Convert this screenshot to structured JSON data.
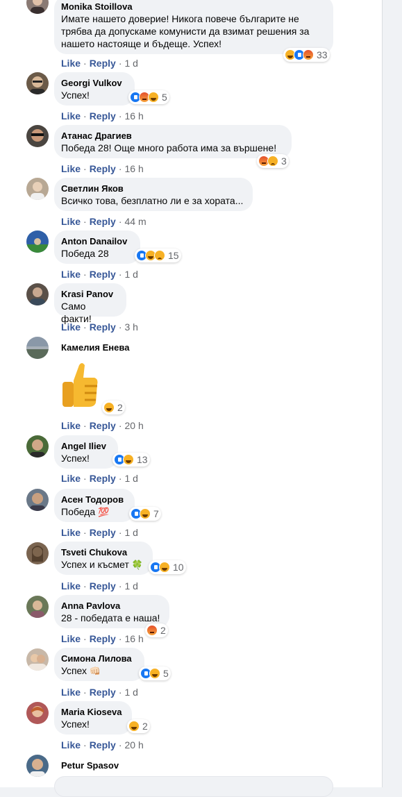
{
  "labels": {
    "like": "Like",
    "reply": "Reply",
    "dot": "·"
  },
  "comments": [
    {
      "name": "Monika Stoillova",
      "text": "Имате нашето доверие! Никога повече българите не\nтрябва да допускаме комунисти да взимат решения за\nнашето настояще и бъдеще. Успех!",
      "reactions": [
        "haha",
        "like",
        "angry"
      ],
      "count": "33",
      "time": "1 d",
      "avatar_color": "#8a7a74"
    },
    {
      "name": "Georgi Vulkov",
      "text": "Успех!",
      "reactions": [
        "like",
        "angry",
        "haha"
      ],
      "count": "5",
      "time": "16 h",
      "avatar_color": "#6b5a48"
    },
    {
      "name": "Атанас Драгиев",
      "text": "Победа 28! Още много работа има за вършене!",
      "reactions": [
        "angry",
        "sad"
      ],
      "count": "3",
      "time": "16 h",
      "avatar_color": "#4a4540"
    },
    {
      "name": "Светлин Яков",
      "text": "Всичко това, безплатно ли е за хората...",
      "reactions": [],
      "count": "",
      "time": "44 m",
      "avatar_color": "#b8a894"
    },
    {
      "name": "Anton Danailov",
      "text": "Победа 28",
      "reactions": [
        "like",
        "haha",
        "sad"
      ],
      "count": "15",
      "time": "1 d",
      "avatar_color": "#2e5fa8"
    },
    {
      "name": "Krasi Panov",
      "text": "Само факти!",
      "reactions": [],
      "count": "",
      "time": "3 h",
      "avatar_color": "#5a5048"
    },
    {
      "name": "Камелия Енева",
      "text": "",
      "reactions": [
        "haha"
      ],
      "count": "2",
      "time": "20 h",
      "avatar_color": "#8a98a8"
    },
    {
      "name": "Angel Iliev",
      "text": "Успех!",
      "reactions": [
        "like",
        "haha"
      ],
      "count": "13",
      "time": "1 d",
      "avatar_color": "#4a6a38"
    },
    {
      "name": "Асен Тодоров",
      "text": "Победа",
      "emoji": "💯",
      "reactions": [
        "like",
        "haha"
      ],
      "count": "7",
      "time": "1 d",
      "avatar_color": "#6a7888"
    },
    {
      "name": "Tsveti Chukova",
      "text": "Успех и късмет",
      "emoji": "🍀",
      "reactions": [
        "like",
        "haha"
      ],
      "count": "10",
      "time": "1 d",
      "avatar_color": "#7a6450"
    },
    {
      "name": "Anna Pavlova",
      "text": "28 - победата е наша!",
      "reactions": [
        "angry"
      ],
      "count": "2",
      "time": "16 h",
      "avatar_color": "#6a7858"
    },
    {
      "name": "Симона Лилова",
      "text": "Успех",
      "emoji": "👊🏻",
      "reactions": [
        "like",
        "haha"
      ],
      "count": "5",
      "time": "1 d",
      "avatar_color": "#c8b8a8"
    },
    {
      "name": "Maria Kioseva",
      "text": "Успех!",
      "reactions": [
        "haha"
      ],
      "count": "2",
      "time": "20 h",
      "avatar_color": "#b05858"
    },
    {
      "name": "Petur Spasov",
      "text": "",
      "reactions": [],
      "count": "",
      "time": "",
      "avatar_color": "#4a6a88"
    }
  ]
}
